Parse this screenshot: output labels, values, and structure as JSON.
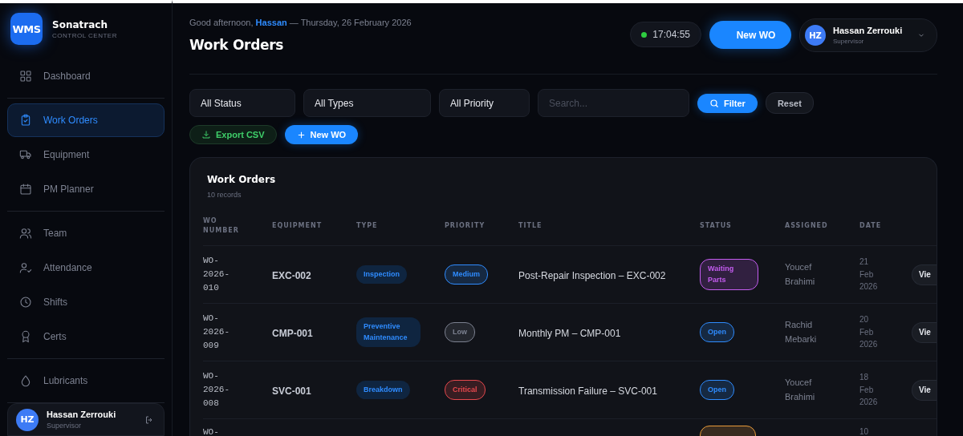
{
  "brand": {
    "logo": "WMS",
    "name": "Sonatrach",
    "subtitle": "CONTROL CENTER"
  },
  "nav_groups": [
    [
      {
        "label": "Dashboard",
        "selected": false
      }
    ],
    [
      {
        "label": "Work Orders",
        "selected": true
      },
      {
        "label": "Equipment",
        "selected": false
      },
      {
        "label": "PM Planner",
        "selected": false
      }
    ],
    [
      {
        "label": "Team",
        "selected": false
      },
      {
        "label": "Attendance",
        "selected": false
      },
      {
        "label": "Shifts",
        "selected": false
      },
      {
        "label": "Certs",
        "selected": false
      }
    ],
    [
      {
        "label": "Lubricants",
        "selected": false
      }
    ]
  ],
  "sidebar_user": {
    "initials": "HZ",
    "name": "Hassan Zerrouki",
    "role": "Supervisor"
  },
  "header": {
    "greeting": "Good afternoon,",
    "user": "Hassan",
    "date": "— Thursday, 26 February 2026",
    "title": "Work Orders",
    "clock": "17:04:55",
    "new_button": "New WO",
    "user_initials": "HZ",
    "user_name": "Hassan Zerrouki",
    "user_role": "Supervisor"
  },
  "filters": {
    "status": "All Status",
    "type": "All Types",
    "priority": "All Priority",
    "search_placeholder": "Search...",
    "filter_button": "Filter",
    "reset_button": "Reset",
    "export_button": "Export CSV",
    "new_button": "New WO"
  },
  "table": {
    "title": "Work Orders",
    "count": "10 records",
    "columns": [
      "WO NUMBER",
      "EQUIPMENT",
      "TYPE",
      "PRIORITY",
      "TITLE",
      "STATUS",
      "ASSIGNED",
      "DATE"
    ],
    "rows": [
      {
        "wo_number": "WO-2026-010",
        "equipment": "EXC-002",
        "type": "Inspection",
        "priority": {
          "label": "Medium",
          "color": "#2f8cff"
        },
        "title": "Post-Repair Inspection – EXC-002",
        "status": {
          "label": "Waiting Parts",
          "color": "#c45cf0"
        },
        "assigned": "Youcef Brahimi",
        "date": "21 Feb 2026",
        "action": "Vie"
      },
      {
        "wo_number": "WO-2026-009",
        "equipment": "CMP-001",
        "type": "Preventive Maintenance",
        "priority": {
          "label": "Low",
          "color": "#7c8190"
        },
        "title": "Monthly PM – CMP-001",
        "status": {
          "label": "Open",
          "color": "#2f8cff"
        },
        "assigned": "Rachid Mebarki",
        "date": "20 Feb 2026",
        "action": "Vie"
      },
      {
        "wo_number": "WO-2026-008",
        "equipment": "SVC-001",
        "type": "Breakdown",
        "priority": {
          "label": "Critical",
          "color": "#e5484d"
        },
        "title": "Transmission Failure – SVC-001",
        "status": {
          "label": "Open",
          "color": "#2f8cff"
        },
        "assigned": "Youcef Brahimi",
        "date": "18 Feb 2026",
        "action": "Vie"
      },
      {
        "wo_number": "WO-",
        "status": {
          "color": "#e89b3a"
        },
        "date": "10"
      }
    ]
  }
}
